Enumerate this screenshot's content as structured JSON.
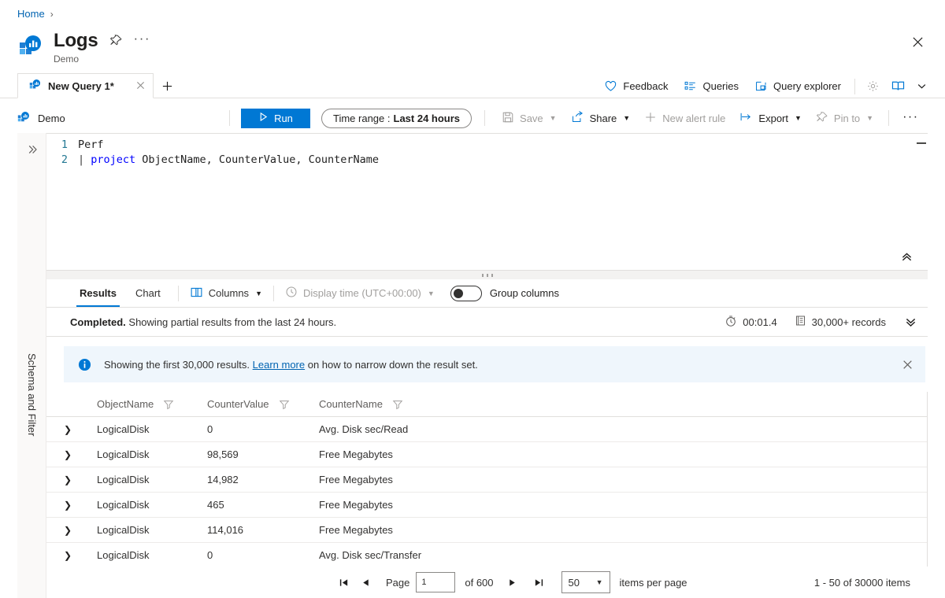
{
  "breadcrumb": {
    "home": "Home",
    "separator": "›"
  },
  "header": {
    "title": "Logs",
    "subtitle": "Demo",
    "logo_icon": "log-analytics-icon",
    "pin_icon": "pin-icon",
    "more_icon": "ellipsis-icon",
    "close_icon": "close-icon"
  },
  "tabstrip": {
    "tab": {
      "label": "New Query 1*",
      "icon": "query-icon",
      "close_icon": "close-icon"
    },
    "new_tab_icon": "plus-icon",
    "actions": [
      {
        "label": "Feedback",
        "icon": "heart-icon"
      },
      {
        "label": "Queries",
        "icon": "list-icon"
      },
      {
        "label": "Query explorer",
        "icon": "explorer-icon"
      }
    ],
    "settings_icon": "gear-icon",
    "book_icon": "book-icon",
    "book_chevron_icon": "chevron-down-icon"
  },
  "commandbar": {
    "scope_label": "Demo",
    "scope_icon": "workspace-icon",
    "run_label": "Run",
    "run_icon": "play-icon",
    "time_range_prefix": "Time range :",
    "time_range_value": "Last 24 hours",
    "items": [
      {
        "label": "Save",
        "icon": "save-icon",
        "has_chevron": true,
        "disabled": true
      },
      {
        "label": "Share",
        "icon": "share-icon",
        "has_chevron": true,
        "disabled": false
      },
      {
        "label": "New alert rule",
        "icon": "plus-icon",
        "has_chevron": false,
        "disabled": true
      },
      {
        "label": "Export",
        "icon": "export-icon",
        "has_chevron": true,
        "disabled": false
      },
      {
        "label": "Pin to",
        "icon": "pin-icon",
        "has_chevron": true,
        "disabled": true
      }
    ],
    "overflow_label": "···"
  },
  "rail": {
    "expand_icon": "chevron-double-right-icon",
    "vertical_label": "Schema and Filter"
  },
  "editor": {
    "lines": [
      {
        "number": "1",
        "plain": "Perf"
      },
      {
        "number": "2",
        "pipe": "| ",
        "keyword": "project",
        "rest": " ObjectName, CounterValue, CounterName"
      }
    ],
    "collapse_icon": "chevron-double-up-icon"
  },
  "results": {
    "tabs": [
      {
        "label": "Results",
        "active": true
      },
      {
        "label": "Chart",
        "active": false
      }
    ],
    "columns_btn": {
      "label": "Columns",
      "icon": "columns-icon",
      "chevron": "chevron-down-icon"
    },
    "display_time_btn": {
      "label": "Display time (UTC+00:00)",
      "icon": "clock-icon",
      "chevron": "chevron-down-icon",
      "disabled": true
    },
    "group_columns": {
      "label": "Group columns",
      "enabled": false
    },
    "status": {
      "bold": "Completed.",
      "text": " Showing partial results from the last 24 hours.",
      "duration_icon": "timer-icon",
      "duration": "00:01.4",
      "records_icon": "records-icon",
      "records": "30,000+ records",
      "expand_icon": "chevron-double-down-icon"
    },
    "banner": {
      "icon": "info-icon",
      "text_before": "Showing the first 30,000 results.",
      "link": "Learn more",
      "text_after": "on how to narrow down the result set.",
      "close_icon": "close-icon",
      "background": "#eff6fc",
      "accent": "#0078d4"
    }
  },
  "grid": {
    "columns": [
      {
        "name": "ObjectName",
        "filter_icon": "filter-icon"
      },
      {
        "name": "CounterValue",
        "filter_icon": "filter-icon"
      },
      {
        "name": "CounterName",
        "filter_icon": "filter-icon"
      }
    ],
    "expand_icon": "chevron-right-icon",
    "rows": [
      {
        "ObjectName": "LogicalDisk",
        "CounterValue": "0",
        "CounterName": "Avg. Disk sec/Read"
      },
      {
        "ObjectName": "LogicalDisk",
        "CounterValue": "98,569",
        "CounterName": "Free Megabytes"
      },
      {
        "ObjectName": "LogicalDisk",
        "CounterValue": "14,982",
        "CounterName": "Free Megabytes"
      },
      {
        "ObjectName": "LogicalDisk",
        "CounterValue": "465",
        "CounterName": "Free Megabytes"
      },
      {
        "ObjectName": "LogicalDisk",
        "CounterValue": "114,016",
        "CounterName": "Free Megabytes"
      },
      {
        "ObjectName": "LogicalDisk",
        "CounterValue": "0",
        "CounterName": "Avg. Disk sec/Transfer"
      }
    ]
  },
  "pager": {
    "first_icon": "page-first-icon",
    "prev_icon": "page-prev-icon",
    "next_icon": "page-next-icon",
    "last_icon": "page-last-icon",
    "page_label": "Page",
    "page_value": "1",
    "of_label": "of 600",
    "items_per_page_value": "50",
    "items_per_page_label": "items per page",
    "range_label": "1 - 50 of 30000 items"
  },
  "colors": {
    "accent": "#0078d4",
    "link": "#0063b1",
    "banner_bg": "#eff6fc",
    "border": "#e1dfdd",
    "rail_bg": "#faf9f8"
  }
}
